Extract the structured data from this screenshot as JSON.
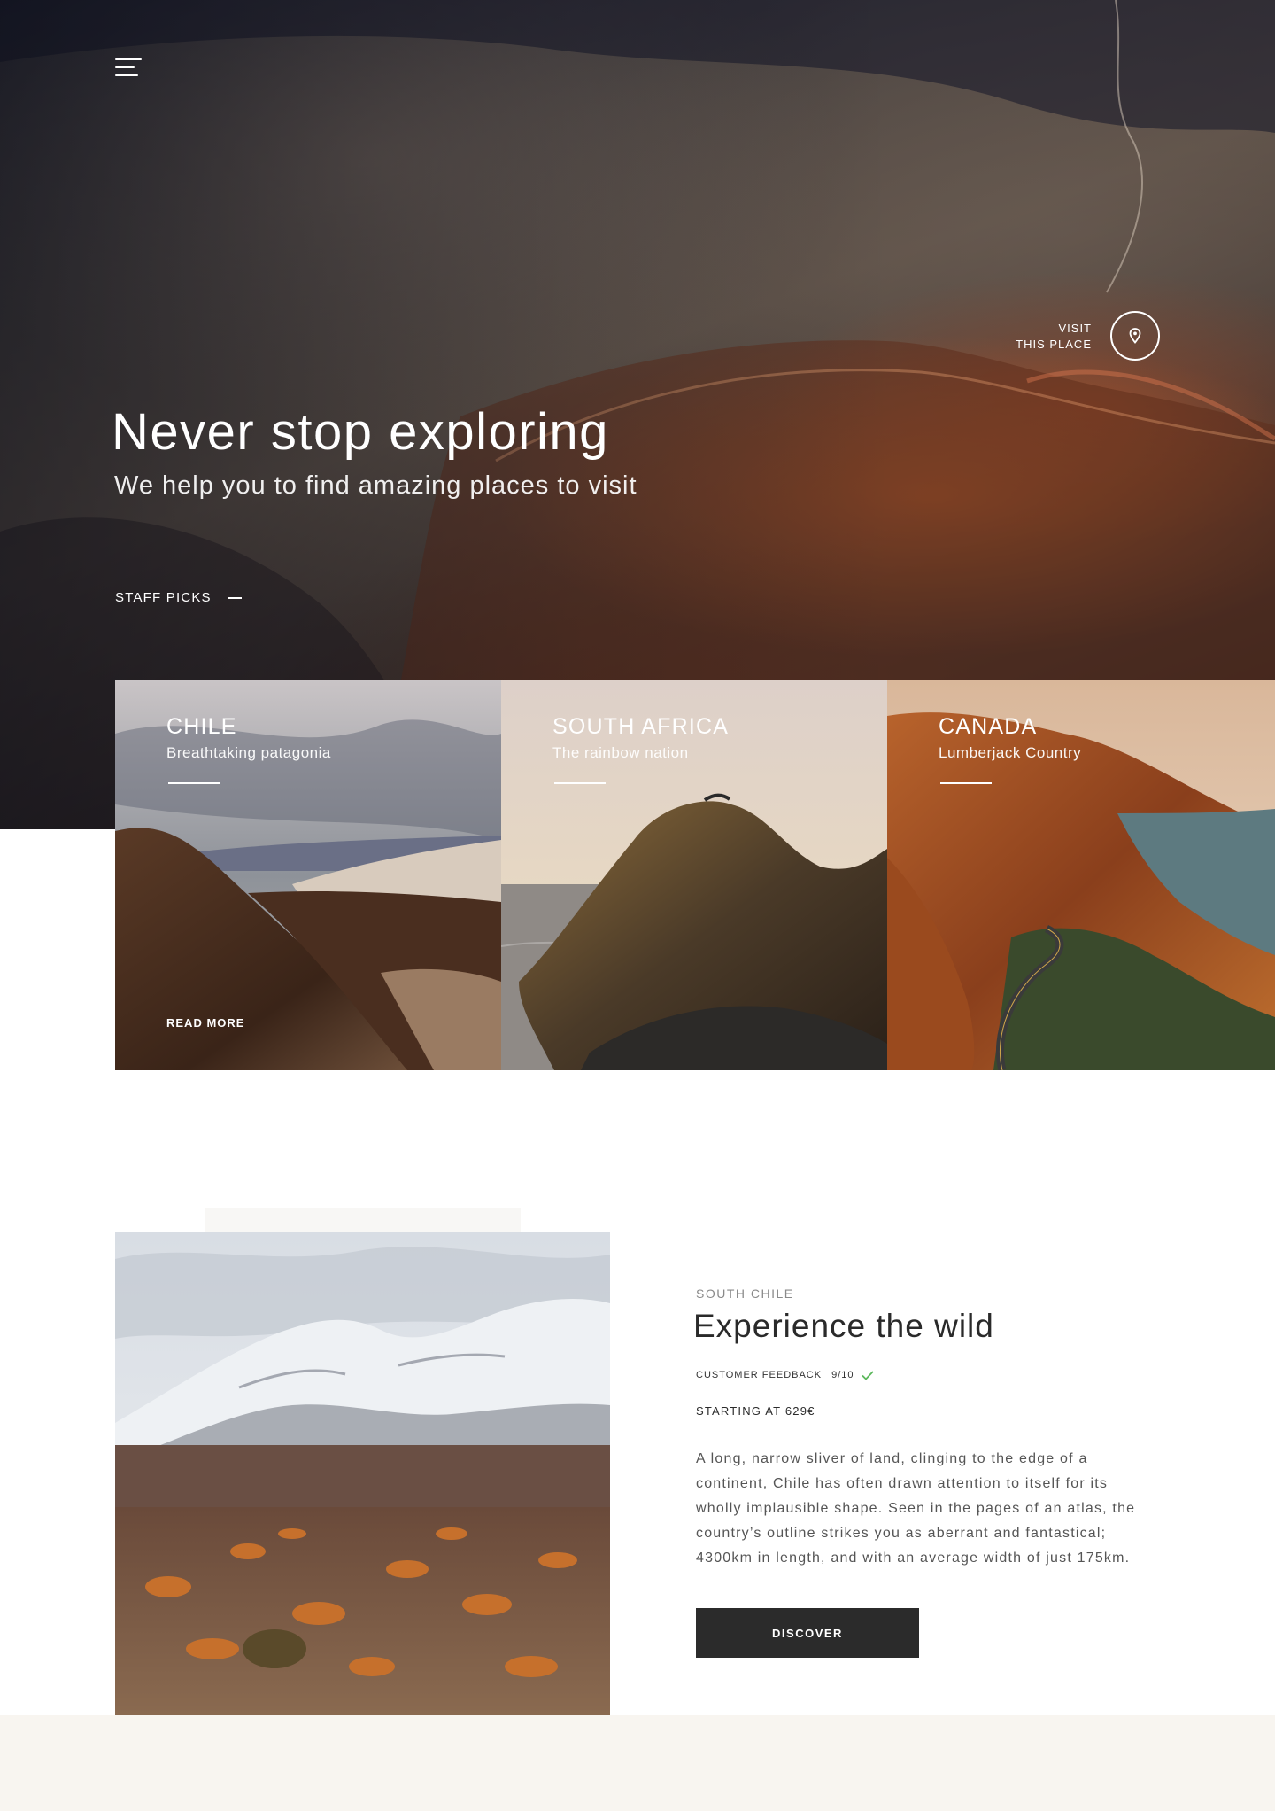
{
  "hero": {
    "title": "Never stop exploring",
    "subtitle": "We help you to find amazing places to visit",
    "visit_line1": "VISIT",
    "visit_line2": "THIS PLACE",
    "staff_picks_label": "STAFF PICKS"
  },
  "icons": {
    "menu": "hamburger-menu-icon",
    "visit": "map-pin-icon",
    "feedback": "checkmark-icon"
  },
  "cards": [
    {
      "title": "CHILE",
      "subtitle": "Breathtaking patagonia",
      "cta": "READ MORE"
    },
    {
      "title": "SOUTH AFRICA",
      "subtitle": "The rainbow nation"
    },
    {
      "title": "CANADA",
      "subtitle": "Lumberjack Country"
    }
  ],
  "feature": {
    "eyebrow": "SOUTH CHILE",
    "title": "Experience the wild",
    "feedback_label": "CUSTOMER FEEDBACK",
    "feedback_score": "9/10",
    "price": "STARTING AT 629€",
    "description": "A long, narrow sliver of land, clinging to the edge of a continent, Chile has often drawn attention to itself for its wholly implausible shape. Seen in the pages of an atlas, the country’s outline strikes you as aberrant and fantastical; 4300km in length, and with an average width of just 175km.",
    "button_label": "DISCOVER"
  },
  "colors": {
    "dark_button": "#2b2b2b",
    "check_green": "#5cb85c",
    "footer_band": "#f8f5f0"
  }
}
